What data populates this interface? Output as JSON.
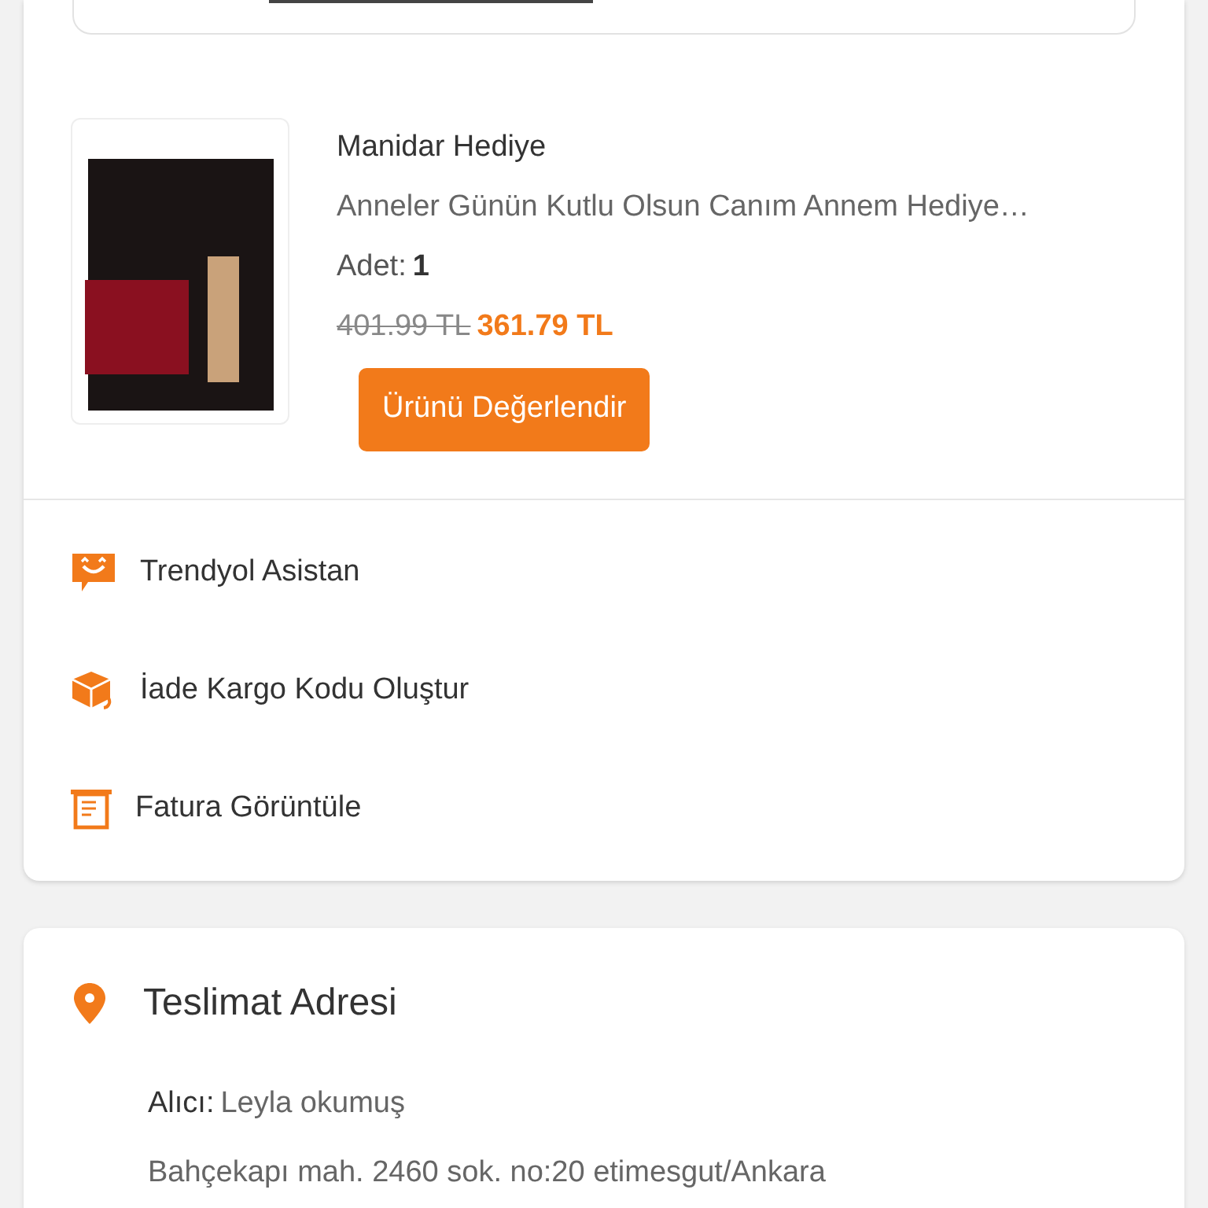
{
  "order_item": {
    "seller": "Manidar Hediye",
    "product_name": "Anneler Günün Kutlu Olsun Canım Annem Hediye…",
    "quantity_label": "Adet:",
    "quantity": "1",
    "old_price": "401.99 TL",
    "price": "361.79 TL",
    "review_button": "Ürünü Değerlendir"
  },
  "actions": [
    {
      "kind": "assistant",
      "label": "Trendyol Asistan"
    },
    {
      "kind": "return",
      "label": "İade Kargo Kodu Oluştur"
    },
    {
      "kind": "invoice",
      "label": "Fatura Görüntüle"
    }
  ],
  "delivery_address": {
    "title": "Teslimat Adresi",
    "recipient_label": "Alıcı:",
    "recipient": "Leyla okumuş",
    "address": "Bahçekapı mah. 2460 sok. no:20 etimesgut/Ankara"
  }
}
